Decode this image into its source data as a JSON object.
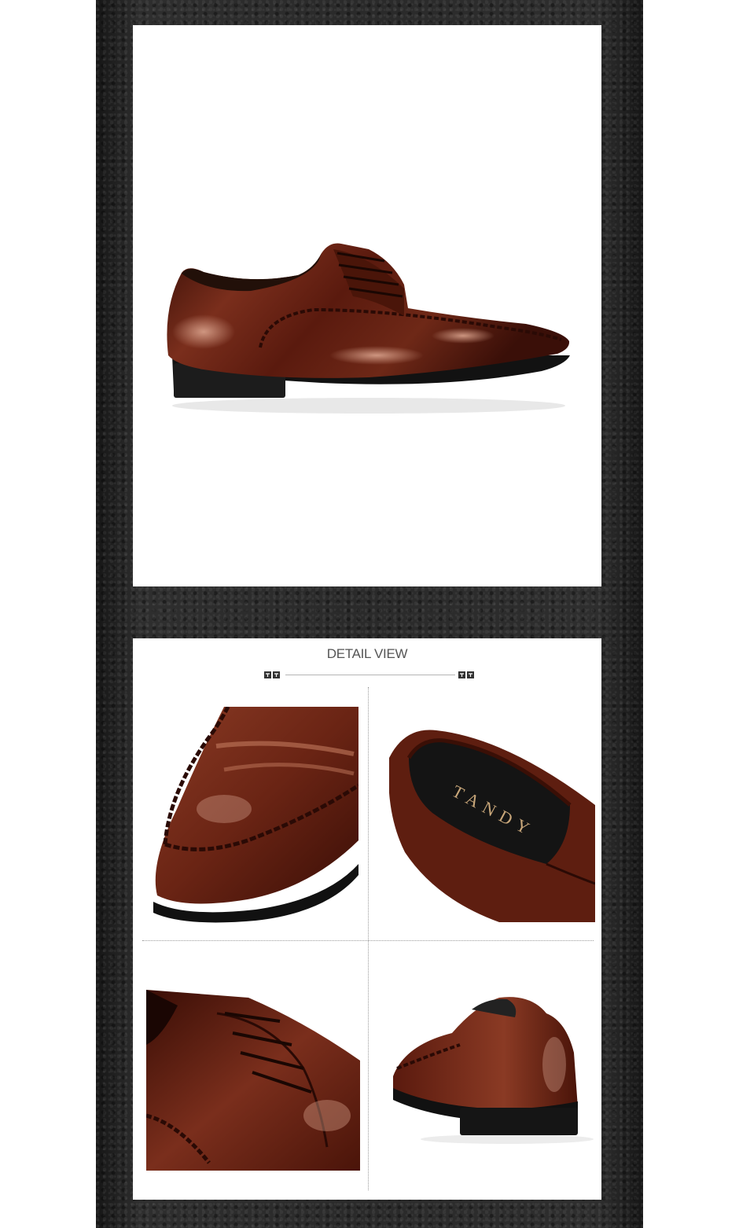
{
  "detail_section": {
    "title": "DETAIL VIEW"
  },
  "product": {
    "insole_brand": "TANDY",
    "colors": {
      "leather": "#5a1e12",
      "sole": "#1a1a1a",
      "background_strip": "#262626"
    }
  },
  "images": {
    "hero": "brown-leather-derby-shoe-side-view",
    "detail_toe": "toe-stitching-closeup",
    "detail_insole": "insole-branding-closeup",
    "detail_laces": "lacing-closeup",
    "detail_heel": "heel-rear-view"
  }
}
